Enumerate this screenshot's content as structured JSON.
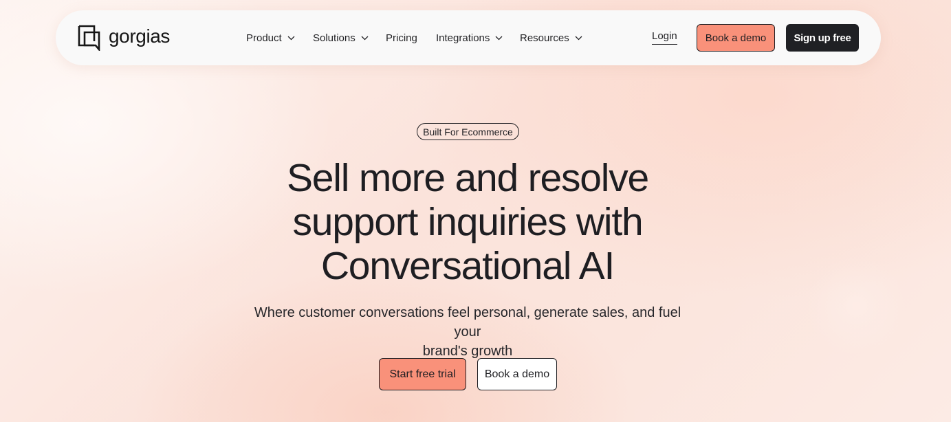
{
  "brand": {
    "name": "gorgias",
    "logo_icon": "gorgias-logo-icon"
  },
  "nav": {
    "items": [
      {
        "label": "Product",
        "has_dropdown": true
      },
      {
        "label": "Solutions",
        "has_dropdown": true
      },
      {
        "label": "Pricing",
        "has_dropdown": false
      },
      {
        "label": "Integrations",
        "has_dropdown": true
      },
      {
        "label": "Resources",
        "has_dropdown": true
      }
    ],
    "login_label": "Login",
    "book_demo_label": "Book a demo",
    "signup_label": "Sign up free"
  },
  "hero": {
    "badge": "Built For Ecommerce",
    "headline_lines": [
      "Sell more and resolve",
      "support inquiries with",
      "Conversational AI"
    ],
    "subheadline_lines": [
      "Where customer conversations feel personal, generate sales, and fuel your",
      "brand's growth"
    ],
    "primary_cta": "Start free trial",
    "secondary_cta": "Book a demo"
  },
  "colors": {
    "accent": "#f9917a",
    "dark": "#1f2024",
    "nav_bg": "#f9f9f9",
    "text": "#1e1e22"
  }
}
